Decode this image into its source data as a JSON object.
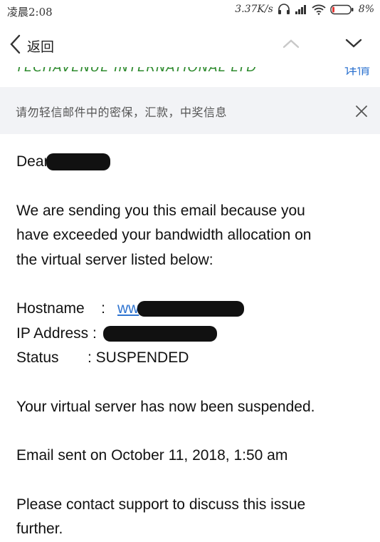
{
  "status_bar": {
    "time": "凌晨2:08",
    "network_speed": "3.37K/s",
    "battery": "8%",
    "icons": [
      "headphones-icon",
      "signal-icon",
      "wifi-icon",
      "battery-icon"
    ]
  },
  "nav": {
    "back_label": "返回",
    "icons": [
      "back-chevron-icon",
      "up-chevron-icon",
      "down-chevron-icon"
    ]
  },
  "sender_strip": {
    "name_partial": "TECHAVENUE INTERNATIONAL LTD",
    "details_link": "详情"
  },
  "banner": {
    "text": "请勿轻信邮件中的密保，汇款，中奖信息",
    "close_icon": "close-icon"
  },
  "email": {
    "greeting": "Dear",
    "para1_line1": "We are sending you this email because you",
    "para1_line2": "have exceeded your bandwidth allocation on",
    "para1_line3": "the virtual server listed below:",
    "hostname_label": "Hostname",
    "hostname_sep": ":",
    "hostname_value_visible": "ww",
    "ip_label": "IP Address",
    "ip_sep": ":",
    "status_label": "Status",
    "status_value": ": SUSPENDED",
    "suspended_line": "Your virtual server has now been suspended.",
    "sent_line": "Email sent on October 11, 2018, 1:50 am",
    "contact_line1": "Please contact support to discuss this issue",
    "contact_line2": "further."
  },
  "colors": {
    "link": "#2f74d0",
    "sender_green": "#2e8b2e",
    "banner_bg": "#f2f3f6",
    "redaction": "#111111"
  }
}
